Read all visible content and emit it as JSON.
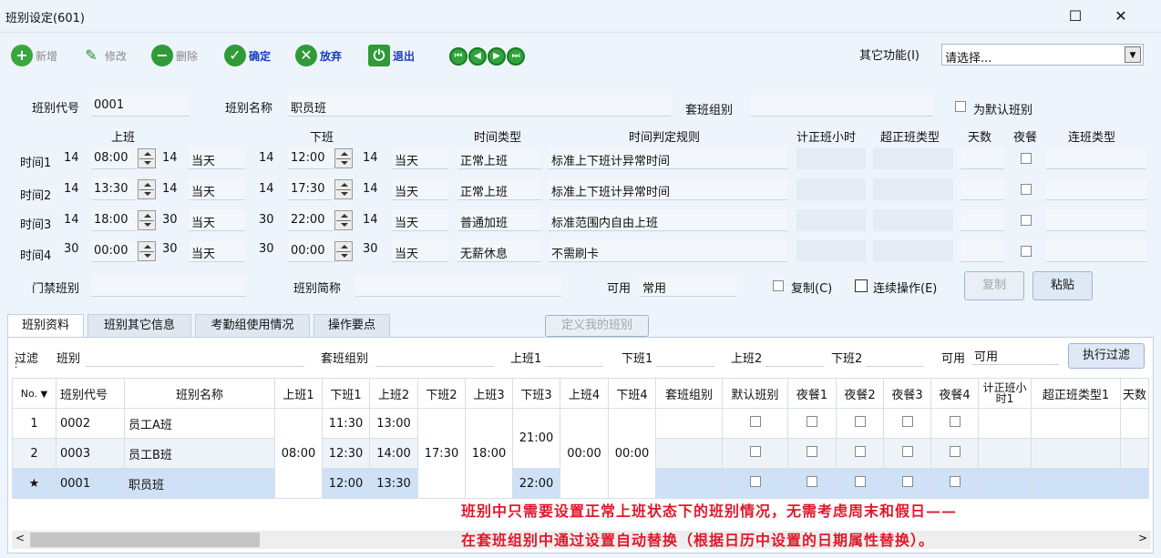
{
  "window": {
    "title": "班别设定(601)",
    "maximize_icon": "☐",
    "close_icon": "✕"
  },
  "toolbar": {
    "new": "新增",
    "edit": "修改",
    "delete": "删除",
    "confirm": "确定",
    "discard": "放弃",
    "exit": "退出",
    "other_label": "其它功能(I)",
    "other_value": "请选择..."
  },
  "form": {
    "code_label": "班别代号",
    "code_value": "0001",
    "name_label": "班别名称",
    "name_value": "职员班",
    "group_label": "套班组别",
    "default_label": "为默认班别",
    "h_on": "上班",
    "h_off": "下班",
    "h_type": "时间类型",
    "h_rule": "时间判定规则",
    "h_hours": "计正班小时",
    "h_ot": "超正班类型",
    "h_days": "天数",
    "h_meal": "夜餐",
    "h_cont": "连班类型",
    "rows": [
      {
        "label": "时间1",
        "a": "14",
        "on_time": "08:00",
        "b": "14",
        "on_day": "当天",
        "c": "14",
        "off_time": "12:00",
        "d": "14",
        "off_day": "当天",
        "type": "正常上班",
        "rule": "标准上下班计异常时间"
      },
      {
        "label": "时间2",
        "a": "14",
        "on_time": "13:30",
        "b": "14",
        "on_day": "当天",
        "c": "14",
        "off_time": "17:30",
        "d": "14",
        "off_day": "当天",
        "type": "正常上班",
        "rule": "标准上下班计异常时间"
      },
      {
        "label": "时间3",
        "a": "14",
        "on_time": "18:00",
        "b": "30",
        "on_day": "当天",
        "c": "30",
        "off_time": "22:00",
        "d": "14",
        "off_day": "当天",
        "type": "普通加班",
        "rule": "标准范围内自由上班"
      },
      {
        "label": "时间4",
        "a": "30",
        "on_time": "00:00",
        "b": "30",
        "on_day": "当天",
        "c": "30",
        "off_time": "00:00",
        "d": "30",
        "off_day": "当天",
        "type": "无薪休息",
        "rule": "不需刷卡"
      }
    ],
    "door_label": "门禁班别",
    "short_label": "班别简称",
    "avail_label": "可用",
    "avail_value": "常用",
    "copy_cb": "复制(C)",
    "cont_cb": "连续操作(E)",
    "copy_btn": "复制",
    "paste_btn": "粘贴"
  },
  "tabs": [
    "班别资料",
    "班别其它信息",
    "考勤组使用情况",
    "操作要点"
  ],
  "define_btn": "定义我的班别",
  "filter": {
    "label": "过滤",
    "colon": ":",
    "shift": "班别",
    "group": "套班组别",
    "on1": "上班1",
    "off1": "下班1",
    "on2": "上班2",
    "off2": "下班2",
    "avail": "可用",
    "avail_value": "可用",
    "exec_btn": "执行过滤"
  },
  "grid": {
    "headers": [
      "No.",
      "班别代号",
      "班别名称",
      "上班1",
      "下班1",
      "上班2",
      "下班2",
      "上班3",
      "下班3",
      "上班4",
      "下班4",
      "套班组别",
      "默认班别",
      "夜餐1",
      "夜餐2",
      "夜餐3",
      "夜餐4",
      "计正班小时1",
      "超正班类型1",
      "天数"
    ],
    "rows": [
      {
        "no": "1",
        "code": "0002",
        "name": "员工A班",
        "off1": "11:30",
        "on2": "13:00"
      },
      {
        "no": "2",
        "code": "0003",
        "name": "员工B班",
        "off1": "12:30",
        "on2": "14:00"
      },
      {
        "no": "★",
        "code": "0001",
        "name": "职员班",
        "off1": "12:00",
        "on2": "13:30",
        "off3": "22:00"
      }
    ],
    "merged_on1": "08:00",
    "merged_off2": "17:30",
    "merged_on3": "18:00",
    "merged_off3": "21:00",
    "merged_on4": "00:00",
    "merged_off4": "00:00"
  },
  "annotation": {
    "line1": "班别中只需要设置正常上班状态下的班别情况，无需考虑周末和假日——",
    "line2": "在套班组别中通过设置自动替换（根据日历中设置的日期属性替换）。"
  }
}
